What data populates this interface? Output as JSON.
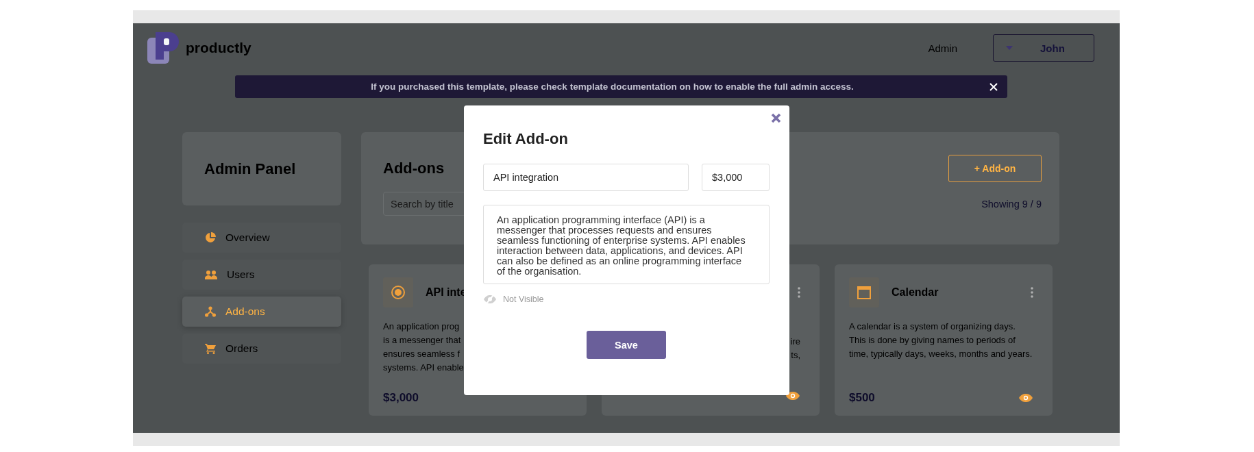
{
  "brand": "productly",
  "user": {
    "role": "Admin",
    "name": "John"
  },
  "banner": {
    "text": "If you purchased this template, please check **template documentation** on how to enable the full admin access."
  },
  "sidebar": {
    "title": "Admin Panel",
    "items": [
      {
        "label": "Overview",
        "kind": "pie",
        "selected": false
      },
      {
        "label": "Users",
        "kind": "users",
        "selected": false
      },
      {
        "label": "Add-ons",
        "kind": "branch",
        "selected": true
      },
      {
        "label": "Orders",
        "kind": "cart",
        "selected": false
      }
    ]
  },
  "main": {
    "title": "Add-ons",
    "search": {
      "placeholder": "Search by title"
    },
    "add_button": "+ Add-on",
    "count": "Showing 9 / 9"
  },
  "cards": [
    {
      "kind": "target",
      "title": "API inte",
      "lines": [
        "An application prog",
        "is a messenger that",
        "ensures seamless f",
        "systems. API enable"
      ],
      "price": "$3,000"
    },
    {
      "kind": "none",
      "lines": [
        "ire",
        "ts,"
      ],
      "visible": true
    },
    {
      "kind": "calendar",
      "title": "Calendar",
      "lines": [
        "A calendar is a system of organizing days.",
        "This is done by giving names to periods of",
        "time, typically days, weeks, months and years."
      ],
      "price": "$500",
      "visible": true
    }
  ],
  "modal": {
    "title": "Edit Add-on",
    "name": "API integration",
    "price": "$3,000",
    "description": "An application programming interface (API) is a messenger that processes requests and ensures seamless functioning of enterprise systems. API enables interaction between data, applications, and devices. API can also be defined as an online programming interface of the organisation.",
    "visible": false,
    "visibility_label": "Not Visible",
    "save": "Save"
  }
}
